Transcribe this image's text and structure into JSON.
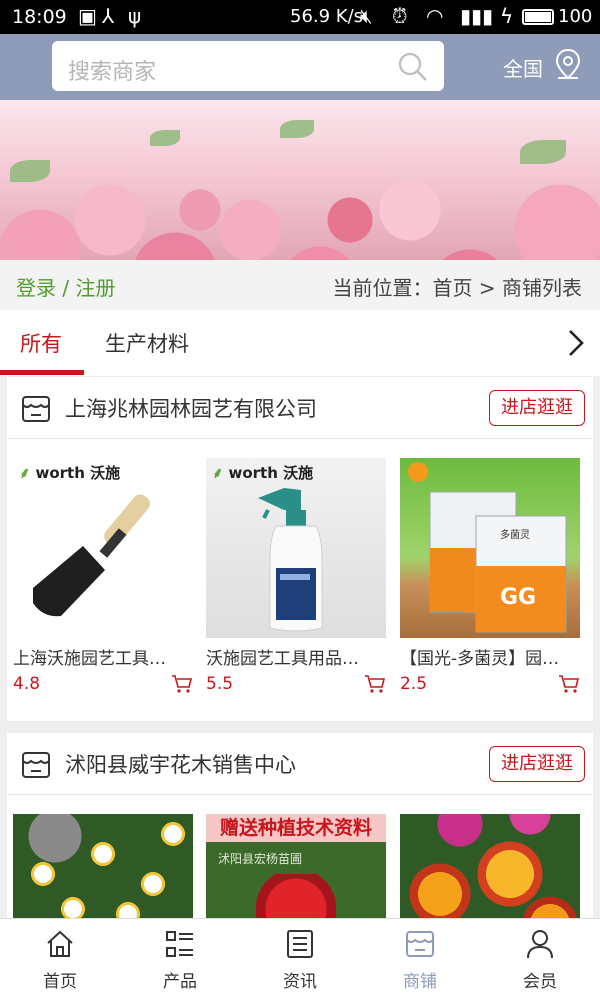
{
  "status_bar": {
    "time": "18:09",
    "speed": "56.9 K/s",
    "battery": "100"
  },
  "header": {
    "search_placeholder": "搜索商家",
    "region": "全国"
  },
  "breadcrumb": {
    "login": "登录 / 注册",
    "location": "当前位置：首页 > 商铺列表"
  },
  "tabs": [
    {
      "label": "所有",
      "active": true
    },
    {
      "label": "生产材料",
      "active": false
    }
  ],
  "shops": [
    {
      "name": "上海兆林园林园艺有限公司",
      "visit_label": "进店逛逛",
      "products": [
        {
          "title": "上海沃施园艺工具…",
          "price": "4.8",
          "brand": "worth沃施"
        },
        {
          "title": "沃施园艺工具用品…",
          "price": "5.5",
          "brand": "worth沃施"
        },
        {
          "title": "【国光-多菌灵】园…",
          "price": "2.5",
          "brand": "国光"
        }
      ]
    },
    {
      "name": "沭阳县威宇花木销售中心",
      "visit_label": "进店逛逛",
      "products": [
        {
          "title": "",
          "price": ""
        },
        {
          "title": "",
          "price": "",
          "overlay": "赠送种植技术资料",
          "watermark": "沭阳县宏杨苗圃"
        },
        {
          "title": "",
          "price": ""
        }
      ]
    }
  ],
  "bottom_nav": [
    {
      "label": "首页",
      "icon": "home-icon",
      "active": false
    },
    {
      "label": "产品",
      "icon": "grid-list-icon",
      "active": false
    },
    {
      "label": "资讯",
      "icon": "news-icon",
      "active": false
    },
    {
      "label": "商铺",
      "icon": "shop-icon",
      "active": true
    },
    {
      "label": "会员",
      "icon": "user-icon",
      "active": false
    }
  ],
  "colors": {
    "header_bg": "#8e9cb9",
    "accent_red": "#c9161c",
    "login_green": "#4f9e2c"
  }
}
